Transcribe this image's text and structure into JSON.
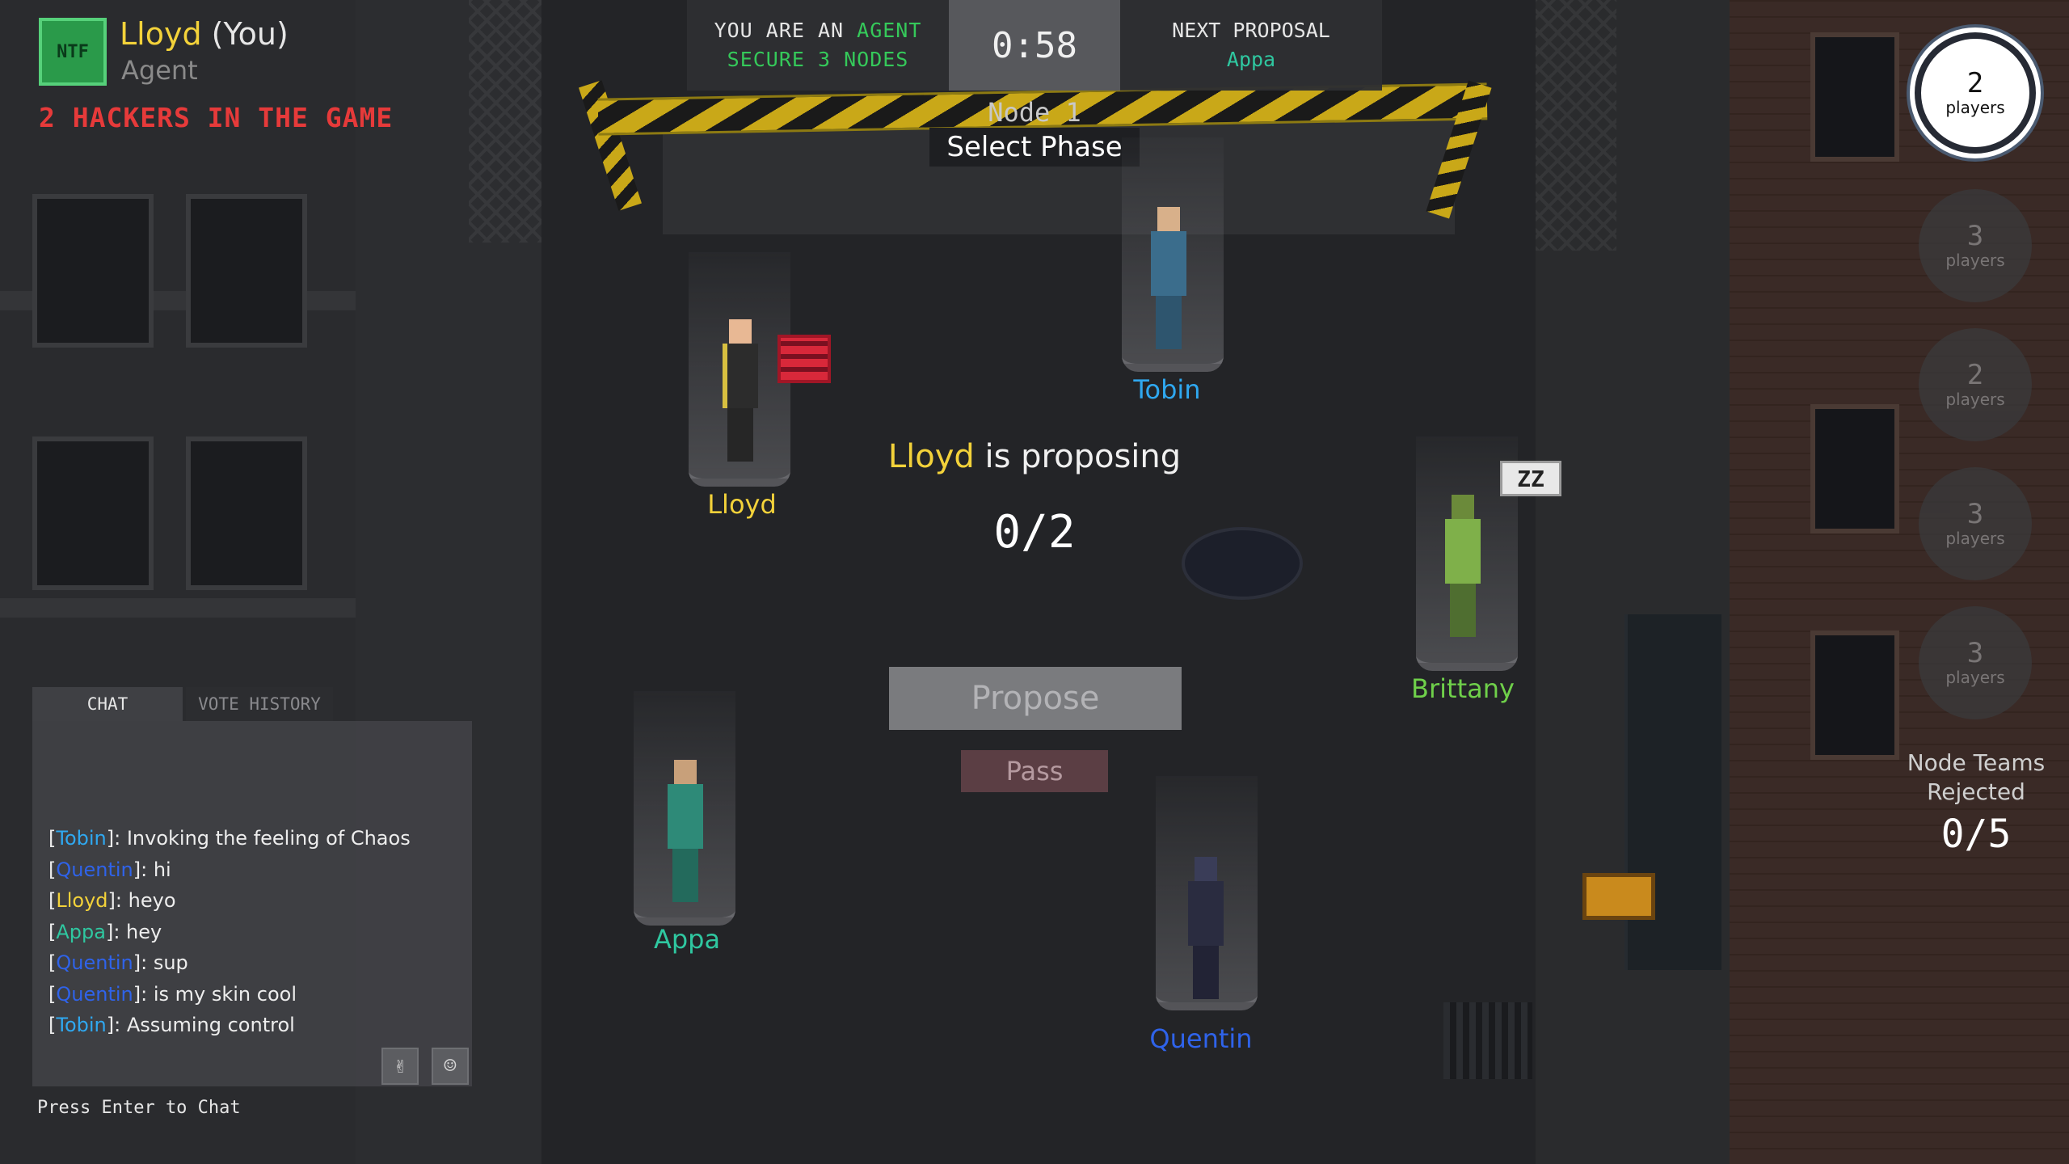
{
  "player": {
    "badge_text": "NTF",
    "name": "Lloyd",
    "you_tag": " (You)",
    "role": "Agent",
    "hackers_notice": "2 HACKERS IN THE GAME"
  },
  "hud": {
    "role_prefix": "YOU ARE AN ",
    "role_name": "AGENT",
    "objective": "SECURE 3 NODES",
    "timer": "0:58",
    "next_label": "NEXT PROPOSAL",
    "next_player": "Appa",
    "node_title": "Node 1",
    "phase": "Select Phase"
  },
  "center": {
    "proposer": "Lloyd",
    "proposing_text": " is proposing",
    "selected_count": "0/2",
    "propose_label": "Propose",
    "pass_label": "Pass"
  },
  "characters": {
    "lloyd": "Lloyd",
    "tobin": "Tobin",
    "brittany": "Brittany",
    "appa": "Appa",
    "quentin": "Quentin",
    "sleep_text": "ZZ"
  },
  "rounds": [
    {
      "num": "2",
      "label": "players"
    },
    {
      "num": "3",
      "label": "players"
    },
    {
      "num": "2",
      "label": "players"
    },
    {
      "num": "3",
      "label": "players"
    },
    {
      "num": "3",
      "label": "players"
    }
  ],
  "rejected": {
    "label_line1": "Node Teams",
    "label_line2": "Rejected",
    "count": "0/5"
  },
  "chat": {
    "tab_chat": "CHAT",
    "tab_vote": "VOTE HISTORY",
    "messages": [
      {
        "user": "Tobin",
        "text": ": Invoking the feeling of Chaos"
      },
      {
        "user": "Quentin",
        "text": ": hi"
      },
      {
        "user": "Lloyd",
        "text": ": heyo"
      },
      {
        "user": "Appa",
        "text": ": hey"
      },
      {
        "user": "Quentin",
        "text": ": sup"
      },
      {
        "user": "Quentin",
        "text": ": is my skin cool"
      },
      {
        "user": "Tobin",
        "text": ": Assuming control"
      }
    ],
    "press_enter": "Press Enter to Chat",
    "gesture_icon": "✌",
    "emoji_icon": "☺"
  },
  "colors": {
    "lloyd": "#f3d23a",
    "tobin": "#2fa8f0",
    "brittany": "#6fd04a",
    "appa": "#2fc7a0",
    "quentin": "#2f63ea",
    "hacker_red": "#e63a3a",
    "agent_green": "#35c95a"
  }
}
